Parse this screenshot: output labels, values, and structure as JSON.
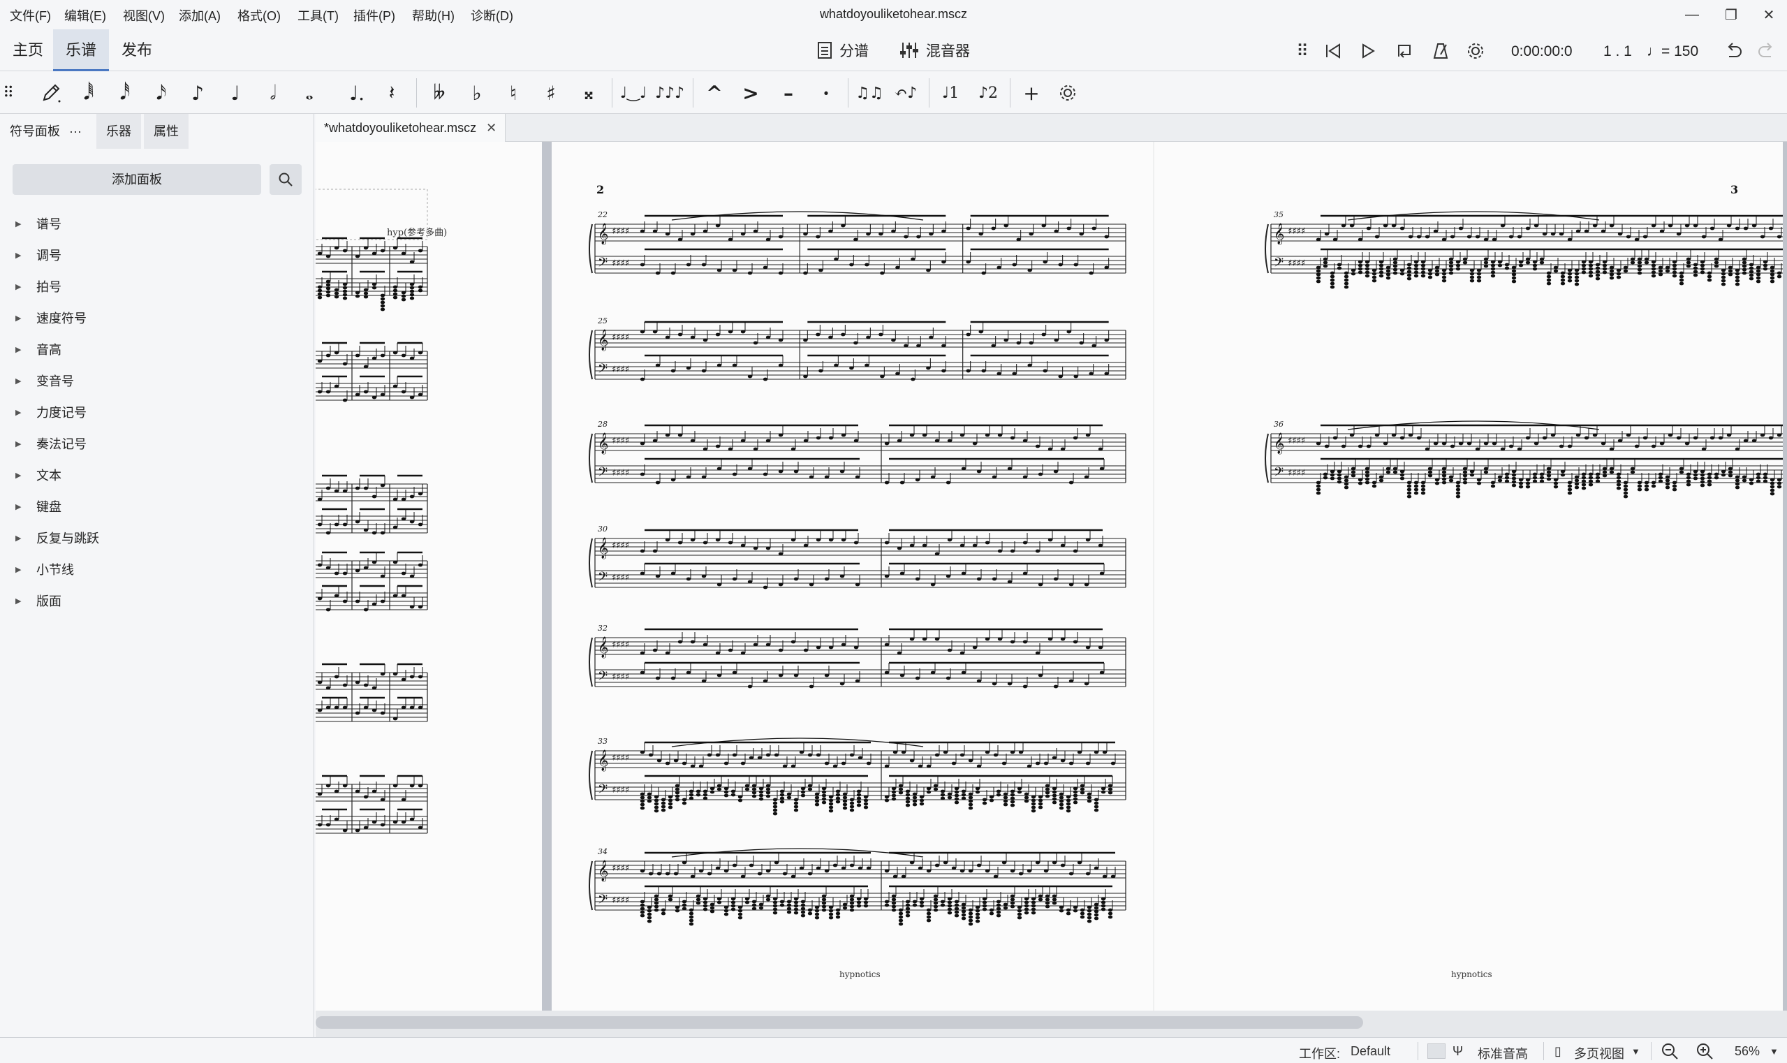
{
  "menu": {
    "items": [
      "文件(F)",
      "编辑(E)",
      "视图(V)",
      "添加(A)",
      "格式(O)",
      "工具(T)",
      "插件(P)",
      "帮助(H)",
      "诊断(D)"
    ],
    "title": "whatdoyouliketohear.mscz"
  },
  "workspace_tabs": [
    "主页",
    "乐谱",
    "发布"
  ],
  "center": {
    "parts_label": "分谱",
    "mixer_label": "混音器"
  },
  "playback": {
    "time": "0:00:00:0",
    "position": "1 . 1",
    "tempo": "♩= 150"
  },
  "left_panel": {
    "tabs": [
      "符号面板",
      "乐器",
      "属性"
    ],
    "more": "···",
    "add_panel": "添加面板",
    "palettes": [
      "谱号",
      "调号",
      "拍号",
      "速度符号",
      "音高",
      "变音号",
      "力度记号",
      "奏法记号",
      "文本",
      "键盘",
      "反复与跳跃",
      "小节线",
      "版面"
    ]
  },
  "document": {
    "tab_name": "*whatdoyouliketohear.mscz"
  },
  "score": {
    "page2_number": "2",
    "page3_number": "3",
    "footer": "hypnotics",
    "tempo_marking": "hyp(参考多曲)",
    "measure_numbers_p2": [
      "22",
      "25",
      "28",
      "30",
      "32",
      "33",
      "34"
    ],
    "measure_numbers_p3": [
      "35",
      "36"
    ]
  },
  "status": {
    "workspace_label": "工作区:",
    "workspace_value": "Default",
    "concert_pitch": "标准音高",
    "view_mode": "多页视图",
    "zoom": "56%"
  },
  "colors": {
    "accent": "#4a78c2",
    "page": "#fbfbfb",
    "canvas": "#c0c4cc"
  }
}
